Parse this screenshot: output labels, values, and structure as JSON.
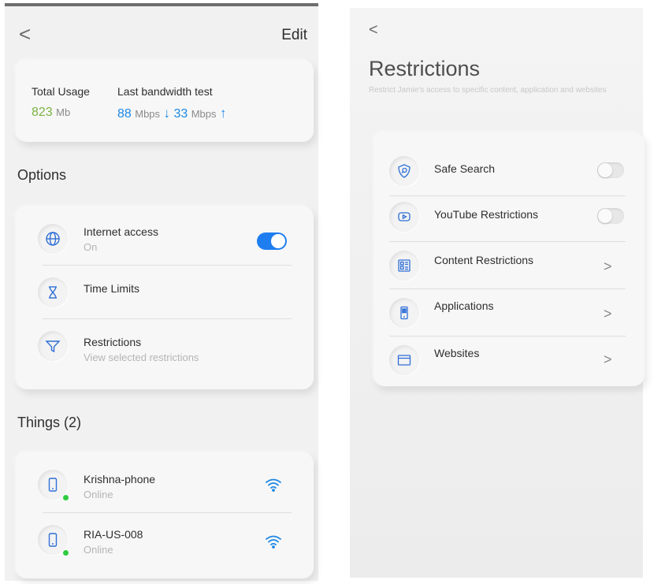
{
  "left": {
    "back_glyph": "<",
    "edit_label": "Edit",
    "usage": {
      "total_label": "Total Usage",
      "total_value": "823",
      "total_unit": "Mb",
      "bandwidth_label": "Last bandwidth test",
      "download_value": "88",
      "download_unit": "Mbps",
      "download_arrow": "↓",
      "upload_value": "33",
      "upload_unit": "Mbps",
      "upload_arrow": "↑"
    },
    "options": {
      "title": "Options",
      "items": [
        {
          "label": "Internet access",
          "sub": "On",
          "icon": "globe-icon",
          "toggle": true
        },
        {
          "label": "Time Limits",
          "sub": "",
          "icon": "hourglass-icon"
        },
        {
          "label": "Restrictions",
          "sub": "View selected restrictions",
          "icon": "filter-icon"
        }
      ]
    },
    "things": {
      "title": "Things (2)",
      "items": [
        {
          "label": "Krishna-phone",
          "sub": "Online",
          "icon": "phone-icon",
          "signal": "wifi-icon"
        },
        {
          "label": "RIA-US-008",
          "sub": "Online",
          "icon": "phone-icon",
          "signal": "wifi-icon"
        }
      ]
    }
  },
  "right": {
    "back_glyph": "<",
    "title": "Restrictions",
    "subtitle": "Restrict Jamie's access to specific content, application and websites",
    "items": [
      {
        "label": "Safe Search",
        "icon": "shield-search-icon",
        "control": "toggle",
        "on": false
      },
      {
        "label": "YouTube Restrictions",
        "icon": "youtube-icon",
        "control": "toggle",
        "on": false
      },
      {
        "label": "Content Restrictions",
        "icon": "content-grid-icon",
        "control": "chevron",
        "glyph": ">"
      },
      {
        "label": "Applications",
        "icon": "app-device-icon",
        "control": "chevron",
        "glyph": ">"
      },
      {
        "label": "Websites",
        "icon": "browser-window-icon",
        "control": "chevron",
        "glyph": ">"
      }
    ]
  },
  "colors": {
    "accent_blue": "#1e7ef0",
    "usage_green": "#7cb342",
    "online_green": "#2ecc40"
  }
}
